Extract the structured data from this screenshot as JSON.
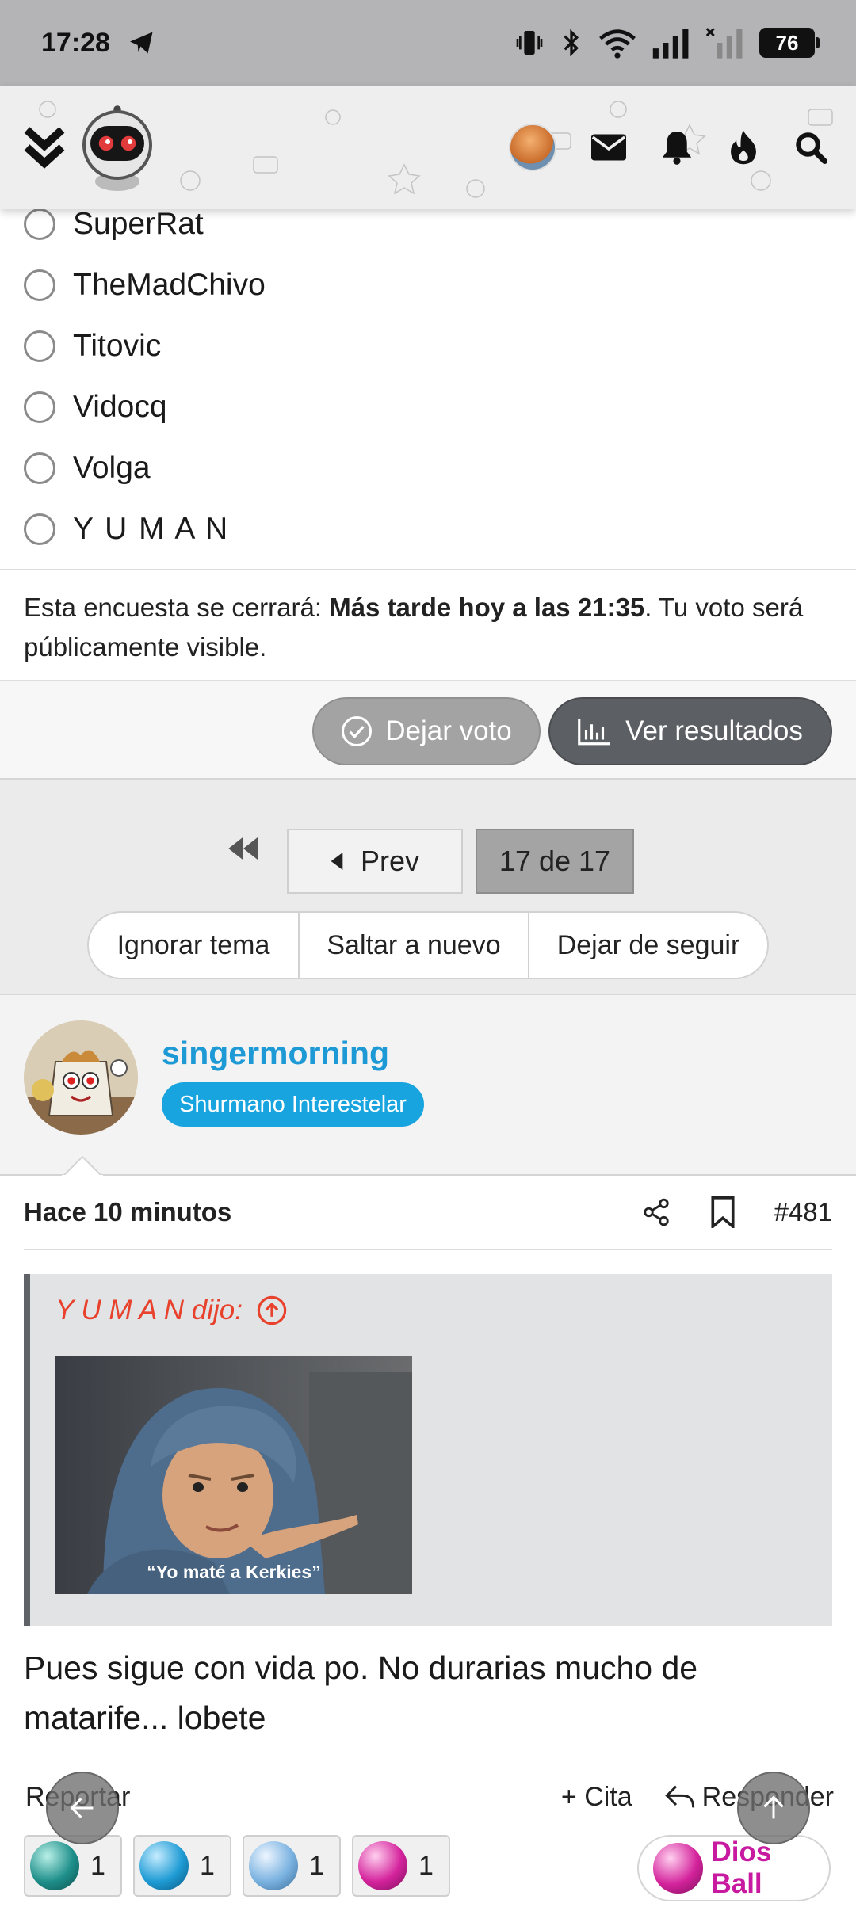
{
  "status_bar": {
    "time": "17:28",
    "battery": "76"
  },
  "poll": {
    "options": [
      "SuperRat",
      "TheMadChivo",
      "Titovic",
      "Vidocq",
      "Volga",
      "Y U M A N"
    ],
    "info_prefix": "Esta encuesta se cerrará: ",
    "info_bold": "Más tarde hoy a las 21:35",
    "info_suffix": ". Tu voto será públicamente visible.",
    "vote_label": "Dejar voto",
    "results_label": "Ver resultados"
  },
  "pagination": {
    "prev_label": "Prev",
    "page_label": "17 de 17"
  },
  "topic_actions": {
    "ignore": "Ignorar tema",
    "jump": "Saltar a nuevo",
    "unfollow": "Dejar de seguir"
  },
  "post": {
    "username": "singermorning",
    "user_title": "Shurmano Interestelar",
    "time": "Hace 10 minutos",
    "number": "#481",
    "quote_author": "Y U M A N dijo:",
    "quote_caption": "“Yo maté a Kerkies”",
    "body": "Pues sigue con vida po. No durarias mucho de matarife... lobete",
    "report_label": "Reportar",
    "quote_label": "+ Cita",
    "reply_label": "Responder",
    "reactions": [
      {
        "icon": "teal-gem-icon",
        "color": "#1f8f8a",
        "count": "1"
      },
      {
        "icon": "blue-gem-icon",
        "color": "#1e9bd4",
        "count": "1"
      },
      {
        "icon": "light-blue-gem-icon",
        "color": "#7ab2e0",
        "count": "1"
      },
      {
        "icon": "magenta-gem-icon",
        "color": "#d4239c",
        "count": "1"
      }
    ],
    "dios_label": "Dios Ball"
  },
  "colors": {
    "accent_blue": "#1d9ad6",
    "quote_red": "#e8412c",
    "dios_magenta": "#c81aa0"
  }
}
